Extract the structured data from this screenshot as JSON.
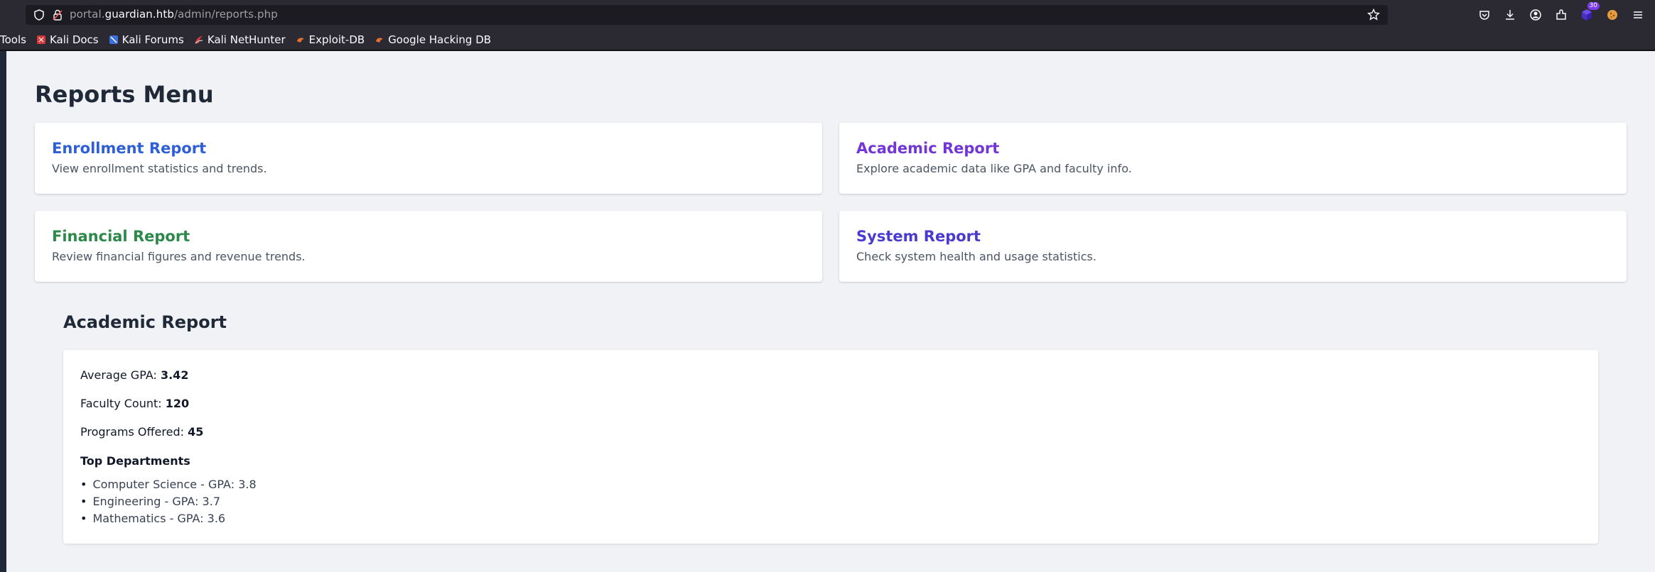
{
  "browser": {
    "url_prefix": "portal.",
    "url_domain": "guardian.htb",
    "url_path": "/admin/reports.php",
    "extension_badge": "30"
  },
  "bookmarks": [
    {
      "label": "Tools",
      "icon": "none"
    },
    {
      "label": "Kali Docs",
      "icon": "kali-docs-icon"
    },
    {
      "label": "Kali Forums",
      "icon": "kali-forums-icon"
    },
    {
      "label": "Kali NetHunter",
      "icon": "kali-nethunter-icon"
    },
    {
      "label": "Exploit-DB",
      "icon": "exploit-db-icon"
    },
    {
      "label": "Google Hacking DB",
      "icon": "ghdb-icon"
    }
  ],
  "page": {
    "title": "Reports Menu",
    "cards": [
      {
        "title": "Enrollment Report",
        "desc": "View enrollment statistics and trends.",
        "color": "#2f5fd6"
      },
      {
        "title": "Academic Report",
        "desc": "Explore academic data like GPA and faculty info.",
        "color": "#7336d6"
      },
      {
        "title": "Financial Report",
        "desc": "Review financial figures and revenue trends.",
        "color": "#2b8a4a"
      },
      {
        "title": "System Report",
        "desc": "Check system health and usage statistics.",
        "color": "#4a3bd0"
      }
    ]
  },
  "report": {
    "title": "Academic Report",
    "avg_gpa_label": "Average GPA:",
    "avg_gpa_value": "3.42",
    "faculty_label": "Faculty Count:",
    "faculty_value": "120",
    "programs_label": "Programs Offered:",
    "programs_value": "45",
    "departments_title": "Top Departments",
    "departments": [
      "Computer Science - GPA: 3.8",
      "Engineering - GPA: 3.7",
      "Mathematics - GPA: 3.6"
    ]
  }
}
